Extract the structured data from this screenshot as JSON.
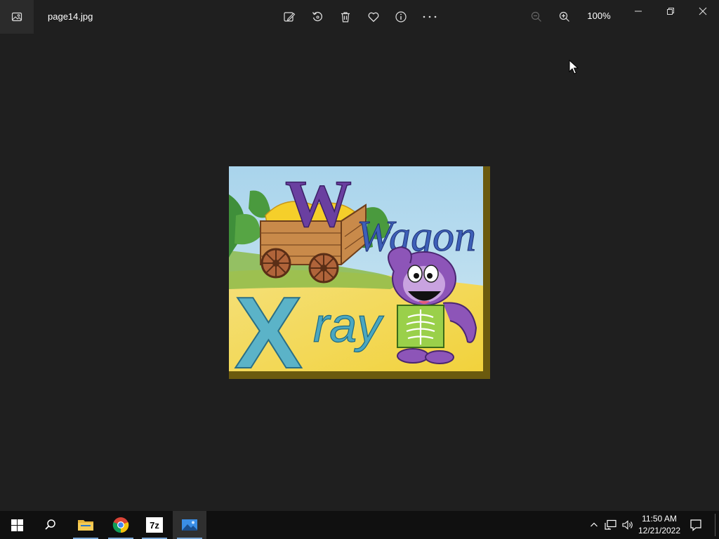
{
  "window": {
    "filename": "page14.jpg",
    "zoom": "100%"
  },
  "toolbar": {
    "items": [
      {
        "id": "edit",
        "icon": "edit-image-icon"
      },
      {
        "id": "rotate",
        "icon": "rotate-icon"
      },
      {
        "id": "delete",
        "icon": "delete-icon"
      },
      {
        "id": "favorite",
        "icon": "heart-icon"
      },
      {
        "id": "info",
        "icon": "info-icon"
      },
      {
        "id": "more",
        "icon": "more-icon"
      }
    ],
    "zoom_out_icon": "zoom-out-icon",
    "zoom_in_icon": "zoom-in-icon"
  },
  "image": {
    "letters_top": "W",
    "word_top": "Wagon",
    "letters_bottom": "X",
    "word_bottom": "ray"
  },
  "taskbar": {
    "apps": [
      "start-icon",
      "search-icon",
      "file-explorer-icon",
      "chrome-icon",
      "7zip-icon",
      "photos-icon"
    ],
    "sevenzip_label": "7z",
    "time": "11:50 AM",
    "date": "12/21/2022"
  },
  "colors": {
    "background": "#1f1f1f",
    "taskbar": "#101010",
    "accent": "#7aa7d6"
  }
}
